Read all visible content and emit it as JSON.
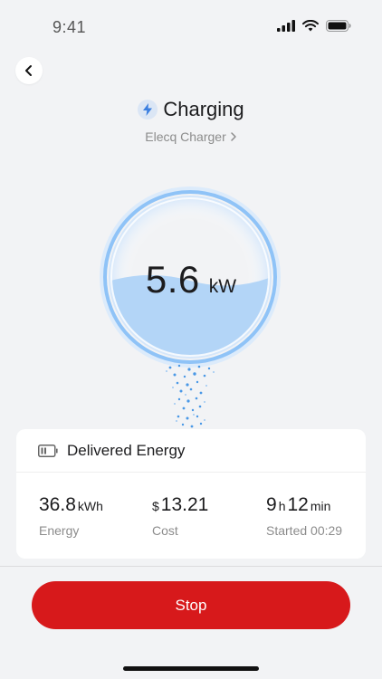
{
  "status_bar": {
    "time": "9:41"
  },
  "header": {
    "title": "Charging",
    "subtitle": "Elecq Charger"
  },
  "gauge": {
    "value": "5.6",
    "unit": "kW"
  },
  "card": {
    "title": "Delivered Energy",
    "stats": [
      {
        "prefix": "",
        "value": "36.8",
        "unit": "kWh",
        "label": "Energy"
      },
      {
        "prefix": "$",
        "value": "13.21",
        "unit": "",
        "label": "Cost"
      },
      {
        "hours": "9",
        "hours_unit": "h",
        "minutes": "12",
        "minutes_unit": "min",
        "label": "Started 00:29"
      }
    ]
  },
  "actions": {
    "stop_label": "Stop"
  },
  "colors": {
    "accent_red": "#d7191b",
    "gauge_blue": "#8fc3f7",
    "bolt_blue": "#3b7fe0"
  }
}
